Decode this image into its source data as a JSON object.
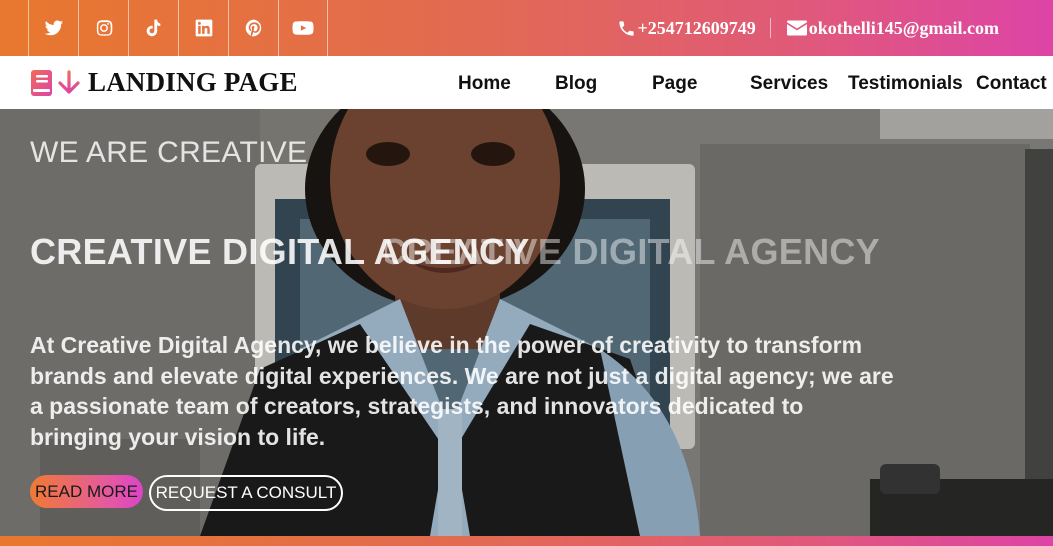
{
  "theme": {
    "gradient_start": "#e8782e",
    "gradient_end": "#dd44a6",
    "button_gradient_start": "#f07a34",
    "button_gradient_end": "#dc44c8"
  },
  "topbar": {
    "social": [
      {
        "icon": "twitter-icon"
      },
      {
        "icon": "instagram-icon"
      },
      {
        "icon": "tiktok-icon"
      },
      {
        "icon": "linkedin-icon"
      },
      {
        "icon": "pinterest-icon"
      },
      {
        "icon": "youtube-icon"
      }
    ],
    "phone": "+254712609749",
    "email": "okothelli145@gmail.com"
  },
  "navbar": {
    "brand": "LANDING PAGE",
    "links": [
      "Home",
      "Blog",
      "Page",
      "Services",
      "Testimonials",
      "Contact"
    ]
  },
  "hero": {
    "eyebrow": "WE ARE CREATIVE",
    "headline": "CREATIVE DIGITAL AGENCY",
    "description": "At Creative Digital Agency, we believe in the power of creativity to transform brands and elevate digital experiences. We are not just a digital agency; we are a passionate team of creators, strategists, and innovators dedicated to bringing your vision to life.",
    "primary_button": "READ MORE",
    "secondary_button": "REQUEST A CONSULT"
  }
}
